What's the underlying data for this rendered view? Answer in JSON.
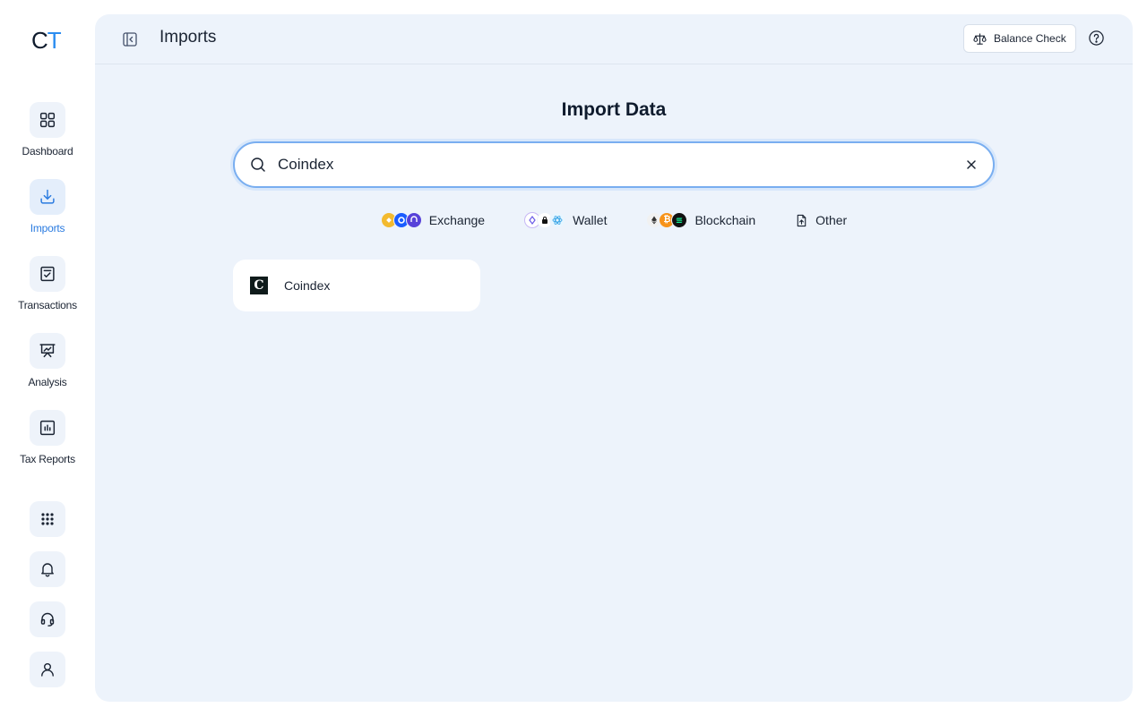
{
  "app": {
    "logo_c": "C",
    "logo_t": "T"
  },
  "sidebar": {
    "items": [
      {
        "label": "Dashboard",
        "icon": "grid-icon"
      },
      {
        "label": "Imports",
        "icon": "download-icon",
        "active": true
      },
      {
        "label": "Transactions",
        "icon": "checklist-icon"
      },
      {
        "label": "Analysis",
        "icon": "presentation-icon"
      },
      {
        "label": "Tax Reports",
        "icon": "bar-report-icon"
      }
    ],
    "utilities": [
      "apps-grid-icon",
      "bell-icon",
      "headset-icon",
      "user-icon"
    ]
  },
  "header": {
    "title": "Imports",
    "balance_check": "Balance Check"
  },
  "main": {
    "heading": "Import Data",
    "search": {
      "value": "Coindex",
      "placeholder": ""
    },
    "filters": [
      {
        "label": "Exchange"
      },
      {
        "label": "Wallet"
      },
      {
        "label": "Blockchain"
      },
      {
        "label": "Other"
      }
    ],
    "results": [
      {
        "name": "Coindex",
        "logo_letter": "C"
      }
    ]
  },
  "colors": {
    "accent": "#2a8cf0",
    "panel": "#edf3fb",
    "search_border": "#79aef0"
  }
}
